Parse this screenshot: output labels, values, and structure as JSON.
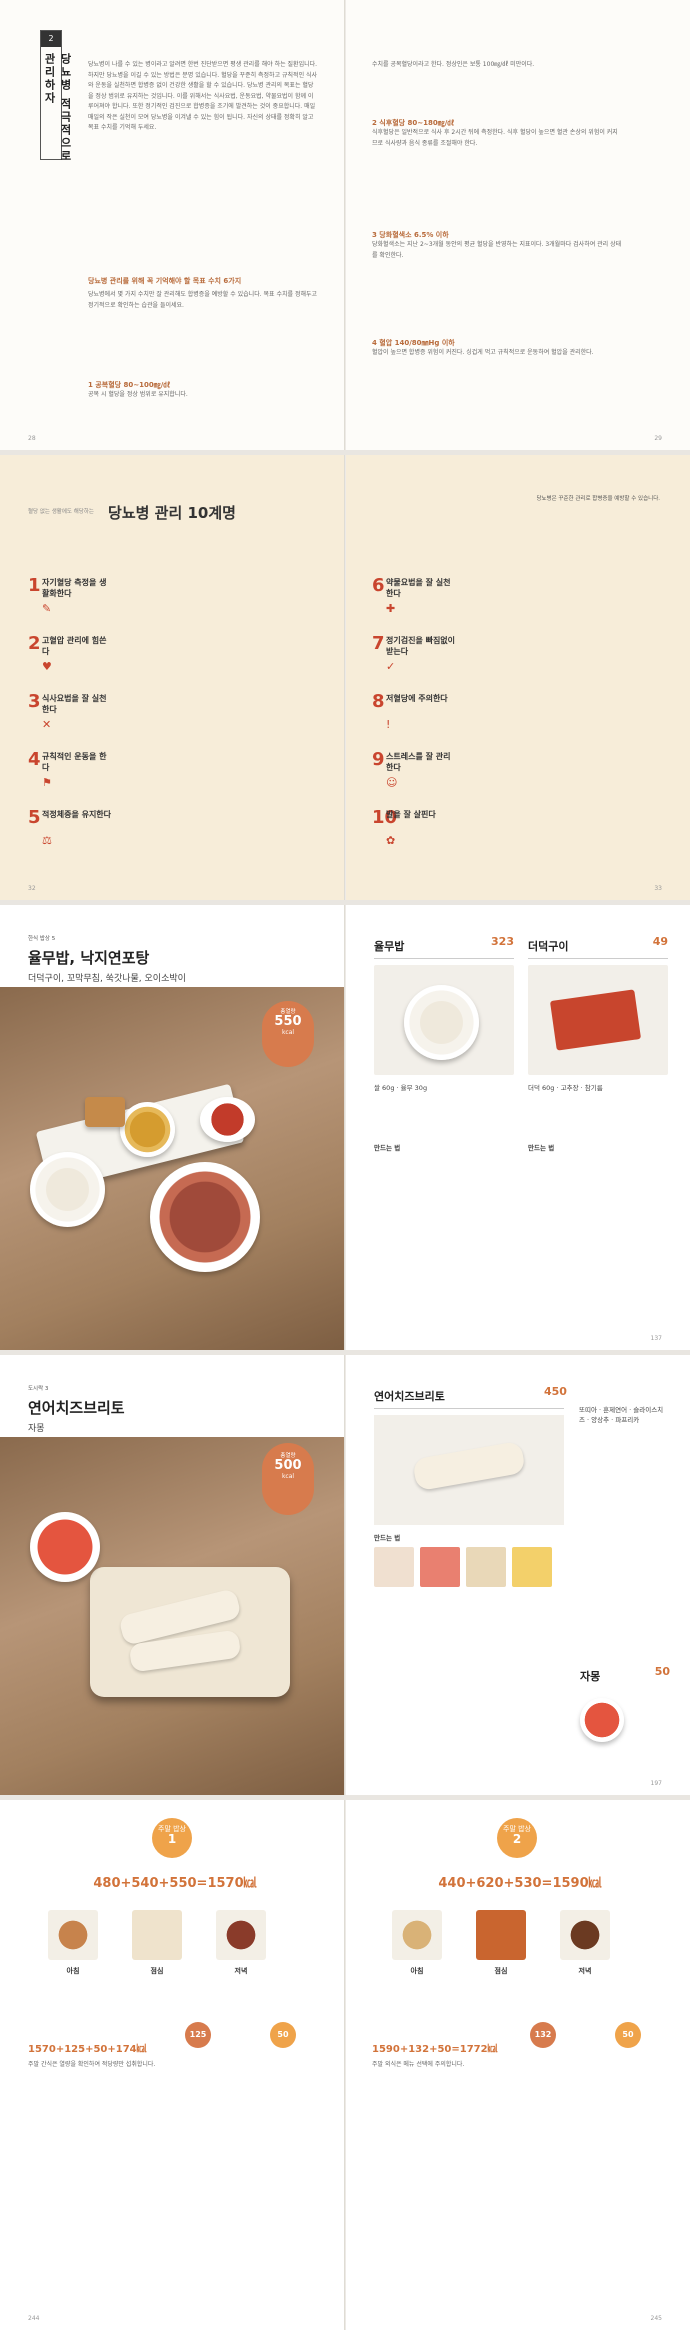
{
  "p1": {
    "chapter_num": "2",
    "chapter_title": "당뇨병 적극적으로 관리하자",
    "left_subhead": "당뇨병 관리를 위해 꼭 기억해야 할 목표 수치 6가지",
    "left_item1": "1 공복혈당 80~100㎎/㎗",
    "right_item2": "2 식후혈당 80~180㎎/㎗",
    "right_item3": "3 당화혈색소 6.5% 이하",
    "right_item4": "4 혈압 140/80㎜Hg 이하",
    "page_left": "28",
    "page_right": "29"
  },
  "p2": {
    "kicker": "혈당 없는 생활에도 해당하는",
    "title": "당뇨병 관리 10계명",
    "note": "당뇨병은 꾸준한 관리로 합병증을 예방할 수 있습니다.",
    "steps": [
      {
        "n": "1",
        "t": "자기혈당 측정을 생활화한다"
      },
      {
        "n": "2",
        "t": "고혈압 관리에 힘쓴다"
      },
      {
        "n": "3",
        "t": "식사요법을 잘 실천한다"
      },
      {
        "n": "4",
        "t": "규칙적인 운동을 한다"
      },
      {
        "n": "5",
        "t": "적정체중을 유지한다"
      },
      {
        "n": "6",
        "t": "약물요법을 잘 실천한다"
      },
      {
        "n": "7",
        "t": "정기검진을 빠짐없이 받는다"
      },
      {
        "n": "8",
        "t": "저혈당에 주의한다"
      },
      {
        "n": "9",
        "t": "스트레스를 잘 관리한다"
      },
      {
        "n": "10",
        "t": "발을 잘 살핀다"
      }
    ],
    "page_left": "32",
    "page_right": "33"
  },
  "p3": {
    "kicker": "한식 밥상 5",
    "title": "율무밥, 낙지연포탕",
    "subtitle": "더덕구이, 꼬막무침, 쑥갓나물, 오이소박이",
    "total_label": "총열량",
    "total_kcal": "550",
    "total_unit": "kcal",
    "dish1_name": "율무밥",
    "dish1_kcal": "323",
    "dish2_name": "더덕구이",
    "dish2_kcal": "49",
    "tips_label": "만드는 법",
    "page_right": "137"
  },
  "p4": {
    "kicker": "도시락 3",
    "title": "연어치즈브리토",
    "subtitle": "자몽",
    "total_label": "총열량",
    "total_kcal": "500",
    "total_unit": "kcal",
    "dish1_name": "연어치즈브리토",
    "dish1_kcal": "450",
    "dish2_name": "자몽",
    "dish2_kcal": "50",
    "tips_label": "만드는 법",
    "page_right": "197"
  },
  "p5": {
    "left": {
      "badge_top": "주말 밥상",
      "badge_num": "1",
      "sum": "480+540+550=1570㎉",
      "meals": [
        "아침",
        "점심",
        "저녁"
      ],
      "sum2": "1570+125+50+174㎉",
      "snack1": "125",
      "snack2": "50"
    },
    "right": {
      "badge_top": "주말 밥상",
      "badge_num": "2",
      "sum": "440+620+530=1590㎉",
      "meals": [
        "아침",
        "점심",
        "저녁"
      ],
      "sum2": "1590+132+50=1772㎉",
      "snack1": "132",
      "snack2": "50"
    },
    "page_left": "244",
    "page_right": "245"
  }
}
